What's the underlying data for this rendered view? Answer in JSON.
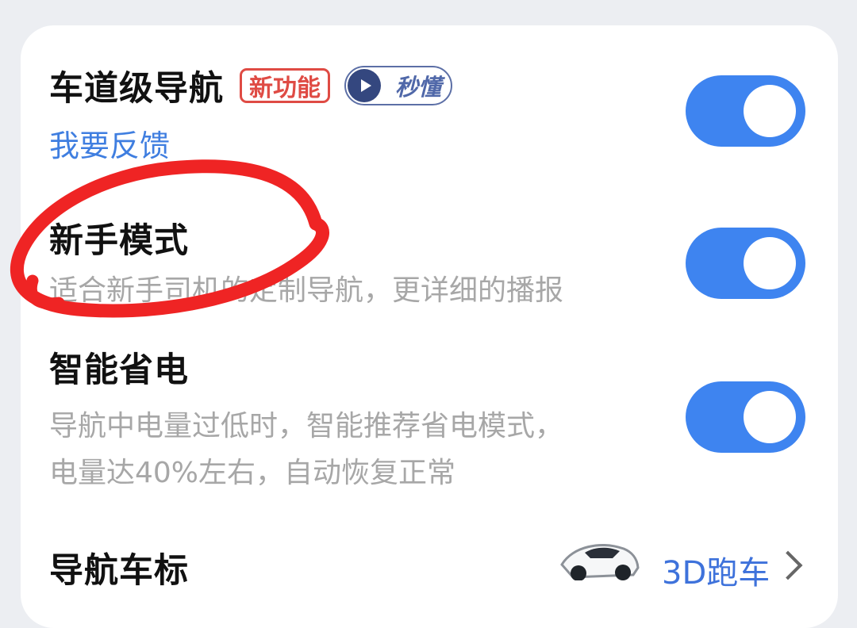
{
  "settings": {
    "lane_navigation": {
      "title": "车道级导航",
      "new_badge": "新功能",
      "video_badge": "秒懂",
      "feedback_link": "我要反馈",
      "enabled": true
    },
    "novice_mode": {
      "title": "新手模式",
      "description": "适合新手司机的定制导航，更详细的播报",
      "enabled": true
    },
    "smart_power_saving": {
      "title": "智能省电",
      "description_line1": "导航中电量过低时，智能推荐省电模式，",
      "description_line2": "电量达40%左右，自动恢复正常",
      "enabled": true
    },
    "nav_car_icon": {
      "title": "导航车标",
      "value": "3D跑车"
    }
  },
  "icons": {
    "play": "play-icon",
    "chevron": "chevron-right-icon",
    "car": "sports-car-thumbnail"
  },
  "colors": {
    "toggle_on": "#3e84f0",
    "link": "#3f7ee0",
    "new_badge": "#df4b44",
    "video_badge": "#5068a9",
    "annotation": "#ef2424"
  }
}
